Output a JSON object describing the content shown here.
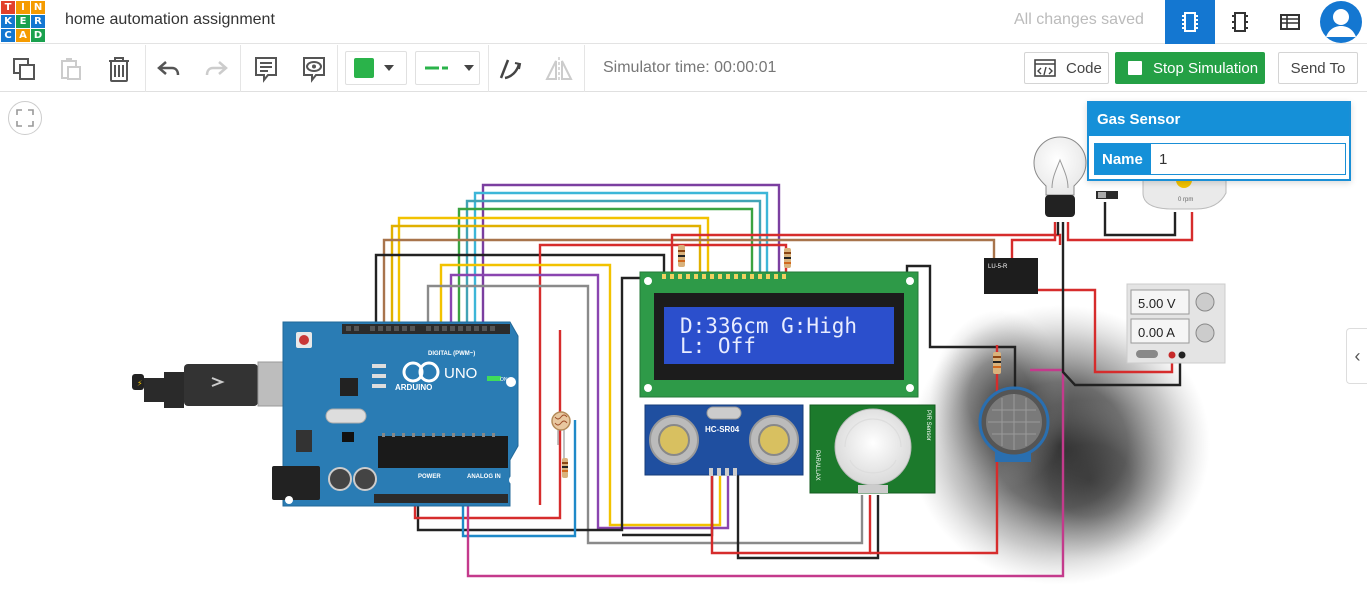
{
  "logo": {
    "letters": [
      "T",
      "I",
      "N",
      "K",
      "E",
      "R",
      "C",
      "A",
      "D"
    ],
    "colors": [
      "#e2402b",
      "#f59b00",
      "#f59b00",
      "#1477d1",
      "#1aa14e",
      "#1477d1",
      "#1477d1",
      "#f59b00",
      "#1aa14e"
    ]
  },
  "header": {
    "project_title": "home automation assignment",
    "save_status": "All changes saved",
    "views": [
      "circuit-view-icon",
      "schematic-view-icon",
      "component-list-icon"
    ]
  },
  "toolbar": {
    "simulator_time": "Simulator time: 00:00:01",
    "code_label": "Code",
    "stop_label": "Stop Simulation",
    "send_label": "Send To",
    "fill_color": "#2ab34a",
    "accent": "#1477d1"
  },
  "inspector": {
    "title": "Gas Sensor",
    "name_label": "Name",
    "name_value": "1"
  },
  "lcd": {
    "line1": "D:336cm G:High",
    "line2": "L: Off"
  },
  "arduino": {
    "brand": "ARDUINO",
    "model": "UNO",
    "digital_label": "DIGITAL (PWM~)",
    "power_label": "POWER",
    "analog_label": "ANALOG IN",
    "on_label": "ON"
  },
  "ultrasonic": {
    "label": "HC-SR04"
  },
  "pir": {
    "label": "PIR Sensor",
    "side_label": "PARALLAX"
  },
  "power_supply": {
    "voltage": "5.00 V",
    "current": "0.00 A"
  },
  "relay": {
    "label": "LU-5-R"
  },
  "motor": {
    "readout": "0 rpm"
  }
}
